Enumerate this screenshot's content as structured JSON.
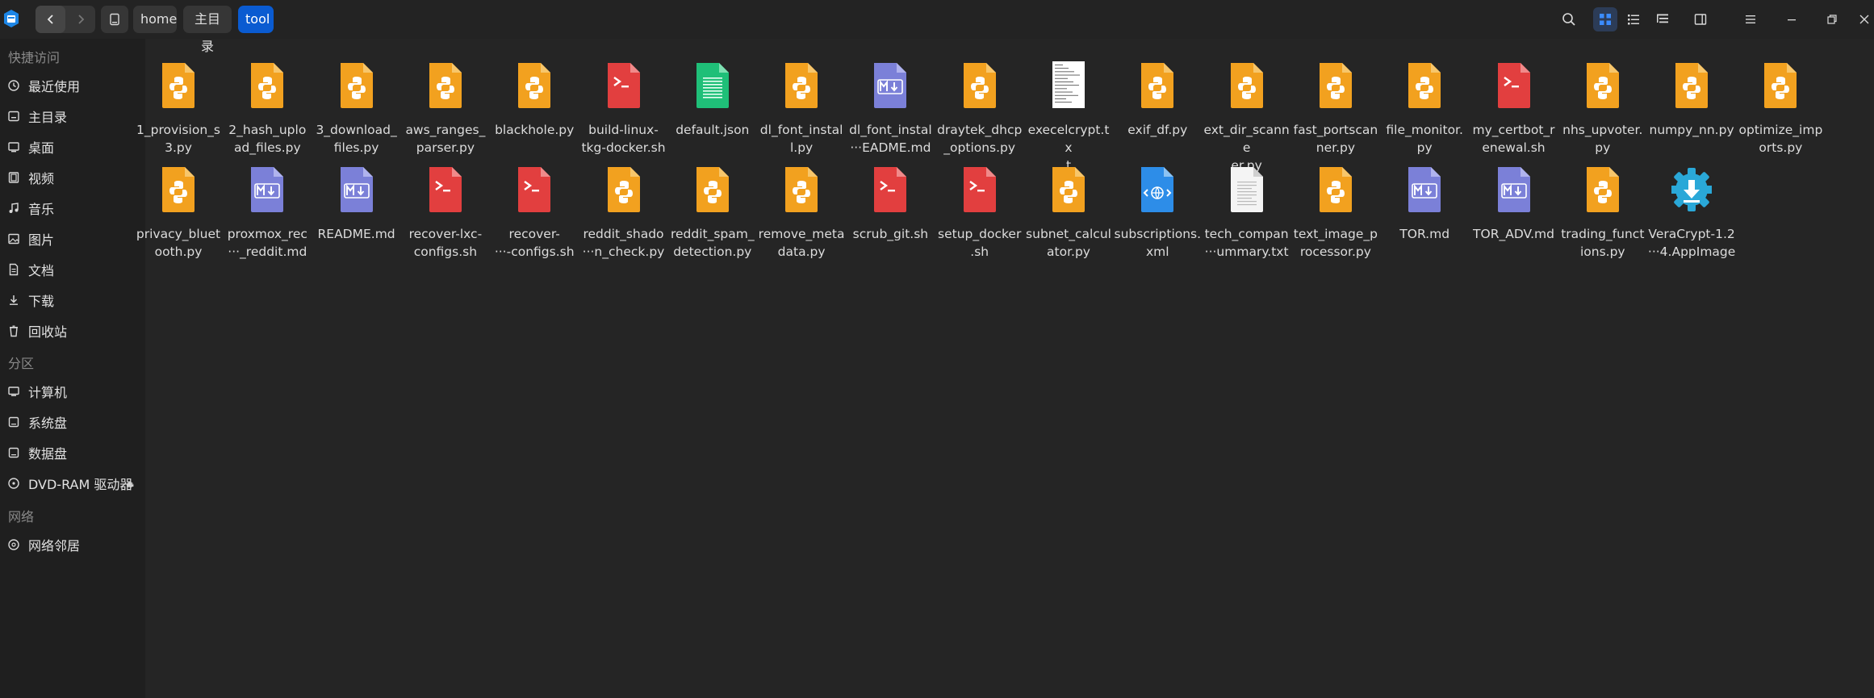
{
  "breadcrumb": [
    "home",
    "主目录",
    "tool"
  ],
  "sidebar": {
    "quick_access": {
      "title": "快捷访问",
      "items": [
        {
          "label": "最近使用",
          "icon": "clock-icon"
        },
        {
          "label": "主目录",
          "icon": "home-icon"
        },
        {
          "label": "桌面",
          "icon": "desktop-icon"
        },
        {
          "label": "视频",
          "icon": "video-icon"
        },
        {
          "label": "音乐",
          "icon": "music-icon"
        },
        {
          "label": "图片",
          "icon": "picture-icon"
        },
        {
          "label": "文档",
          "icon": "document-icon"
        },
        {
          "label": "下载",
          "icon": "download-icon"
        },
        {
          "label": "回收站",
          "icon": "trash-icon"
        }
      ]
    },
    "partitions": {
      "title": "分区",
      "items": [
        {
          "label": "计算机",
          "icon": "computer-icon"
        },
        {
          "label": "系统盘",
          "icon": "disk-icon"
        },
        {
          "label": "数据盘",
          "icon": "disk-icon"
        },
        {
          "label": "DVD-RAM 驱动器",
          "icon": "dvd-icon"
        }
      ]
    },
    "network": {
      "title": "网络",
      "items": [
        {
          "label": "网络邻居",
          "icon": "network-icon"
        }
      ]
    }
  },
  "files": [
    {
      "name": "1_provision_s\n3.py",
      "type": "python"
    },
    {
      "name": "2_hash_uplo\nad_files.py",
      "type": "python"
    },
    {
      "name": "3_download_\nfiles.py",
      "type": "python"
    },
    {
      "name": "aws_ranges_\nparser.py",
      "type": "python"
    },
    {
      "name": "blackhole.py",
      "type": "python"
    },
    {
      "name": "build-linux-\ntkg-docker.sh",
      "type": "shell"
    },
    {
      "name": "default.json",
      "type": "json"
    },
    {
      "name": "dl_font_instal\nl.py",
      "type": "python"
    },
    {
      "name": "dl_font_instal\n···EADME.md",
      "type": "markdown"
    },
    {
      "name": "draytek_dhcp\n_options.py",
      "type": "python"
    },
    {
      "name": "execelcrypt.tx\nt",
      "type": "text-preview"
    },
    {
      "name": "exif_df.py",
      "type": "python"
    },
    {
      "name": "ext_dir_scanne\ner.py",
      "type": "python"
    },
    {
      "name": "fast_portscan\nner.py",
      "type": "python"
    },
    {
      "name": "file_monitor.\npy",
      "type": "python"
    },
    {
      "name": "my_certbot_r\nenewal.sh",
      "type": "shell"
    },
    {
      "name": "nhs_upvoter.\npy",
      "type": "python"
    },
    {
      "name": "numpy_nn.py",
      "type": "python"
    },
    {
      "name": "optimize_imp\norts.py",
      "type": "python"
    },
    {
      "name": "privacy_bluet\nooth.py",
      "type": "python"
    },
    {
      "name": "proxmox_rec\n···_reddit.md",
      "type": "markdown"
    },
    {
      "name": "README.md",
      "type": "markdown"
    },
    {
      "name": "recover-lxc-\nconfigs.sh",
      "type": "shell"
    },
    {
      "name": "recover-\n···-configs.sh",
      "type": "shell"
    },
    {
      "name": "reddit_shado\n···n_check.py",
      "type": "python"
    },
    {
      "name": "reddit_spam_\ndetection.py",
      "type": "python"
    },
    {
      "name": "remove_meta\ndata.py",
      "type": "python"
    },
    {
      "name": "scrub_git.sh",
      "type": "shell"
    },
    {
      "name": "setup_docker\n.sh",
      "type": "shell"
    },
    {
      "name": "subnet_calcul\nator.py",
      "type": "python"
    },
    {
      "name": "subscriptions.\nxml",
      "type": "xml"
    },
    {
      "name": "tech_compan\n···ummary.txt",
      "type": "text"
    },
    {
      "name": "text_image_p\nrocessor.py",
      "type": "python"
    },
    {
      "name": "TOR.md",
      "type": "markdown"
    },
    {
      "name": "TOR_ADV.md",
      "type": "markdown"
    },
    {
      "name": "trading_funct\nions.py",
      "type": "python"
    },
    {
      "name": "VeraCrypt-1.2\n···4.AppImage",
      "type": "appimage"
    }
  ],
  "colors": {
    "python": "#f2a11f",
    "shell": "#e23f3f",
    "markdown": "#7b80d8",
    "json": "#1fbf78",
    "xml": "#2d8de8",
    "appimage": "#2aa8d8",
    "accent": "#0a5bd1"
  }
}
